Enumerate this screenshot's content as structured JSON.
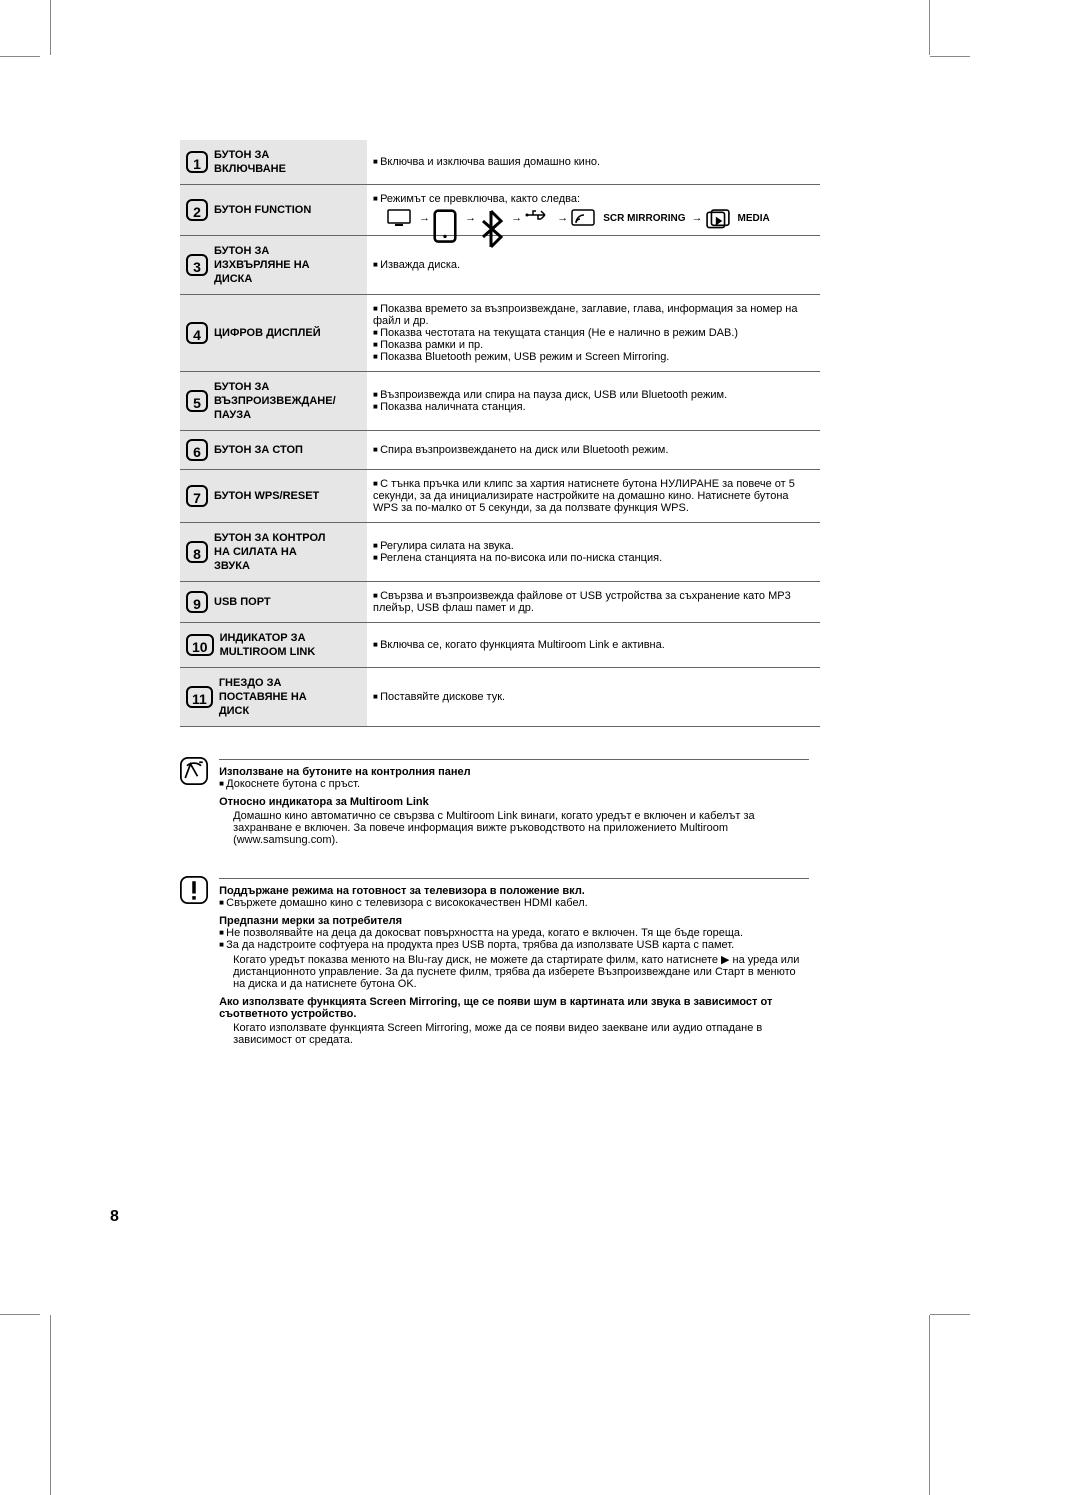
{
  "page_number": "8",
  "table": [
    {
      "num": "1",
      "label": "БУТОН ЗА ВКЛЮЧВАНЕ",
      "desc": [
        "Включва и изключва вашия домашно кино."
      ]
    },
    {
      "num": "2",
      "label": "БУТОН FUNCTION",
      "desc": [
        "Режимът се превключва, както следва:"
      ],
      "icons": true
    },
    {
      "num": "3",
      "label": "БУТОН ЗА ИЗХВЪРЛЯНЕ НА ДИСКА",
      "desc": [
        "Изважда диска."
      ]
    },
    {
      "num": "4",
      "label": "ЦИФРОВ ДИСПЛЕЙ",
      "desc": [
        "Показва времето за възпроизвеждане, заглавие, глава, информация за номер на файл и др.",
        "Показва честотата на текущата станция (Не е налично в режим DAB.)",
        "Показва рамки и пр.",
        "Показва Bluetooth режим, USB режим и Screen Mirroring."
      ]
    },
    {
      "num": "5",
      "label": "БУТОН ЗА ВЪЗПРОИЗВЕЖДАНЕ/ПАУЗА",
      "desc": [
        "Възпроизвежда или спира на пауза диск, USB или Bluetooth режим.",
        "Показва наличната станция."
      ]
    },
    {
      "num": "6",
      "label": "БУТОН ЗА СТОП",
      "desc": [
        "Спира възпроизвеждането на диск или Bluetooth режим."
      ]
    },
    {
      "num": "7",
      "label": "БУТОН WPS/RESET",
      "desc": [
        "С тънка пръчка или клипс за хартия натиснете бутона НУЛИРАНЕ за повече от 5 секунди, за да инициализирате настройките на домашно кино. Натиснете бутона WPS за по-малко от 5 секунди, за да ползвате функция WPS."
      ]
    },
    {
      "num": "8",
      "label": "БУТОН ЗА КОНТРОЛ НА СИЛАТА НА ЗВУКА",
      "desc": [
        "Регулира силата на звука.",
        "Реглена станцията на по-висока или по-ниска станция."
      ]
    },
    {
      "num": "9",
      "label": "USB ПОРТ",
      "desc": [
        "Свързва и възпроизвежда файлове от USB устройства за съхранение като MP3 плейър, USB флаш памет и др."
      ]
    },
    {
      "num": "10",
      "label": "ИНДИКАТОР ЗА MULTIROOM LINK",
      "desc": [
        "Включва се, когато функцията Multiroom Link е активна."
      ]
    },
    {
      "num": "11",
      "label": "ГНЕЗДО ЗА ПОСТАВЯНЕ НА ДИСК",
      "desc": [
        "Поставяйте дискове тук."
      ]
    }
  ],
  "icon_seq_trail_label": "SCR MIRRORING",
  "icon_last_label": "MEDIA",
  "note": {
    "head1": "Използване на бутоните на контролния панел",
    "b1": "Докоснете бутона с пръст.",
    "head2": "Относно индикатора за Multiroom Link",
    "b2": "Домашно кино автоматично се свързва с Multiroom Link винаги, когато уредът е включен и кабелът за захранване е включен. За повече информация вижте ръководството на приложението Multiroom (www.samsung.com)."
  },
  "caution": {
    "head1": "Поддържане режима на готовност за телевизора в положение вкл.",
    "b1": "Свържете домашно кино с телевизора с висококачествен HDMI кабел.",
    "head2": "Предпазни мерки за потребителя",
    "b2a": "Не позволявайте на деца да докосват повърхността на уреда, когато е включен. Тя ще бъде гореща.",
    "b2b": "За да надстроите софтуера на продукта през USB порта, трябва да използвате USB карта с памет.",
    "b3": "Когато уредът показва менюто на Blu-ray диск, не можете да стартирате филм, като натиснете ▶ на уреда или дистанционното управление. За да пуснете филм, трябва да изберете Възпроизвеждане или Старт в менюто на диска и да натиснете бутона OK.",
    "head3": "Ако използвате функцията Screen Mirroring, ще се появи шум в картината или звука в зависимост от съответното устройство.",
    "b4": "Когато използвате функцията Screen Mirroring, може да се появи видео заекване или аудио отпадане в зависимост от средата."
  }
}
